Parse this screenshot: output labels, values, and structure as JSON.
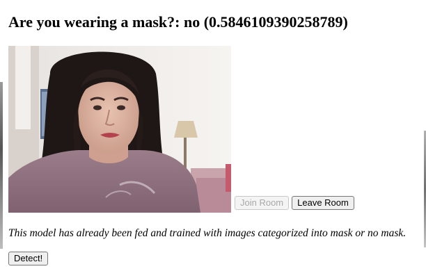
{
  "header": {
    "title": "Are you wearing a mask?: no (0.5846109390258789)"
  },
  "video": {
    "subject": "webcam-feed-woman"
  },
  "room_controls": {
    "join_label": "Join Room",
    "join_enabled": false,
    "leave_label": "Leave Room"
  },
  "description": {
    "text": "This model has already been fed and trained with images categorized into mask or no mask."
  },
  "detect": {
    "label": "Detect!"
  }
}
